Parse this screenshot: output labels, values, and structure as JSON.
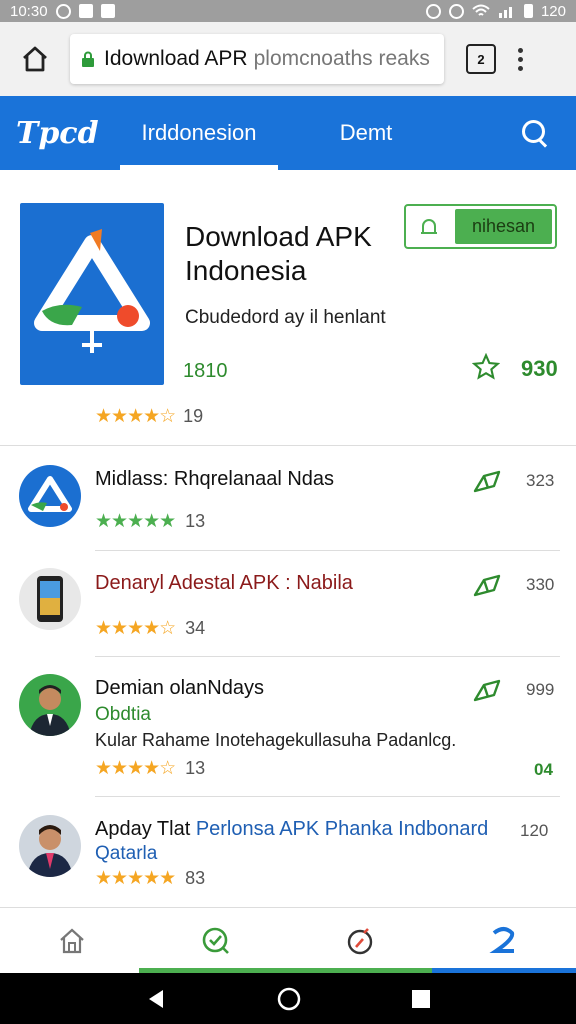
{
  "status_bar": {
    "time": "10:30",
    "battery": "120"
  },
  "browser": {
    "url_host": "Idownload APR",
    "url_path": "plomcnoaths reaks",
    "tab_count": "2"
  },
  "app_bar": {
    "logo": "Tpcd",
    "tabs": [
      {
        "label": "Irddonesion"
      },
      {
        "label": "Demt"
      }
    ]
  },
  "hero": {
    "title_line1": "Download APK",
    "title_line2": "Indonesia",
    "subtitle": "Cbudedord ay il henlant",
    "install_label": "nihesan",
    "size": "1810",
    "count": "930",
    "stars": "★★★★☆",
    "rating_count": "19"
  },
  "items": [
    {
      "title": "Midlass: Rhqrelanaal Ndas",
      "stars": "★★★★★",
      "rating_count": "13",
      "count": "323"
    },
    {
      "title": "Denaryl Adestal APK : Nabila",
      "stars": "★★★★☆",
      "rating_count": "34",
      "count": "330"
    },
    {
      "title": "Demian olanNdays",
      "sub": "Obdtia",
      "desc": "Kular Rahame Inotehagekullasuha Padanlcg.",
      "stars": "★★★★☆",
      "rating_count": "13",
      "count": "999",
      "badge": "04"
    },
    {
      "title_black": "Apday Tlat",
      "title_blue": "Perlonsa APK Phanka Indbonard",
      "sub": "Qatarla",
      "stars": "★★★★★",
      "rating_count": "83",
      "count": "120"
    }
  ],
  "colors": {
    "accent_blue": "#1a73d9",
    "green": "#4caf50",
    "star": "#f5a623",
    "red_title": "#8b1a1a",
    "blue_title": "#1f5fb3"
  }
}
